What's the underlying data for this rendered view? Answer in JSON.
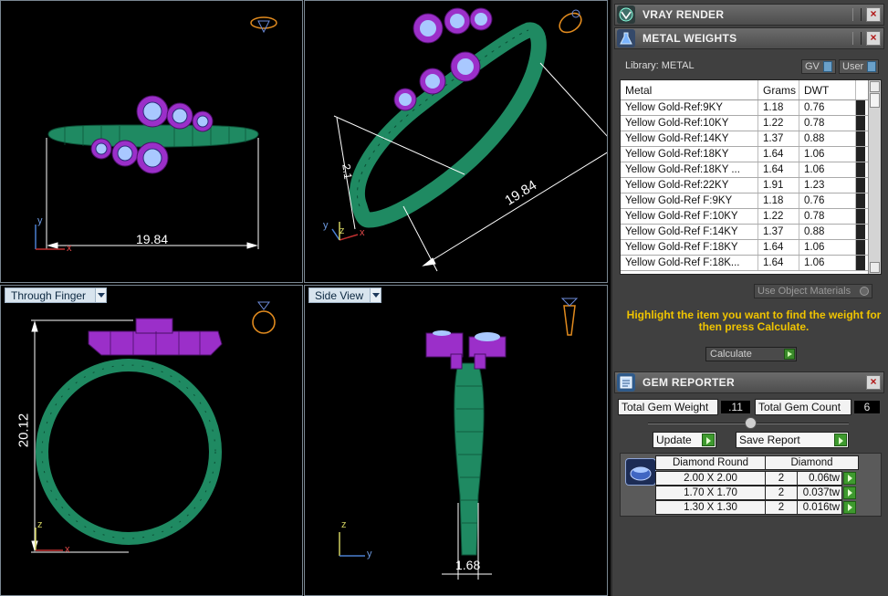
{
  "viewports": {
    "top_left": {
      "dimension": "19.84"
    },
    "top_right": {
      "dimension": "19.84",
      "dimension_small": "2.1"
    },
    "bottom_left": {
      "tab_label": "Through Finger",
      "dimension": "20.12"
    },
    "bottom_right": {
      "tab_label": "Side View",
      "dimension": "1.68"
    },
    "axes": {
      "x": "x",
      "y": "y",
      "z": "z"
    }
  },
  "panel": {
    "vray": {
      "title": "VRAY RENDER",
      "close": "×"
    },
    "metal_weights": {
      "title": "METAL WEIGHTS",
      "close": "×",
      "library_label": "Library: METAL",
      "gv_label": "GV",
      "user_label": "User",
      "columns": [
        "Metal",
        "Grams",
        "DWT"
      ],
      "rows": [
        [
          "Yellow Gold-Ref:9KY",
          "1.18",
          "0.76"
        ],
        [
          "Yellow Gold-Ref:10KY",
          "1.22",
          "0.78"
        ],
        [
          "Yellow Gold-Ref:14KY",
          "1.37",
          "0.88"
        ],
        [
          "Yellow Gold-Ref:18KY",
          "1.64",
          "1.06"
        ],
        [
          "Yellow Gold-Ref:18KY ...",
          "1.64",
          "1.06"
        ],
        [
          "Yellow Gold-Ref:22KY",
          "1.91",
          "1.23"
        ],
        [
          "Yellow Gold-Ref F:9KY",
          "1.18",
          "0.76"
        ],
        [
          "Yellow Gold-Ref F:10KY",
          "1.22",
          "0.78"
        ],
        [
          "Yellow Gold-Ref F:14KY",
          "1.37",
          "0.88"
        ],
        [
          "Yellow Gold-Ref F:18KY",
          "1.64",
          "1.06"
        ],
        [
          "Yellow Gold-Ref F:18K...",
          "1.64",
          "1.06"
        ]
      ],
      "use_object_materials": "Use Object Materials",
      "instructions": "Highlight the item you want to find the weight for then press Calculate.",
      "calculate_label": "Calculate"
    },
    "gem_reporter": {
      "title": "GEM REPORTER",
      "close": "×",
      "total_weight_label": "Total Gem Weight",
      "total_weight_value": ".11",
      "total_count_label": "Total Gem Count",
      "total_count_value": "6",
      "update_label": "Update",
      "save_report_label": "Save Report",
      "gem_type": "Diamond Round",
      "material": "Diamond",
      "rows": [
        {
          "size": "2.00 X 2.00",
          "count": "2",
          "weight": "0.06tw"
        },
        {
          "size": "1.70 X 1.70",
          "count": "2",
          "weight": "0.037tw"
        },
        {
          "size": "1.30 X 1.30",
          "count": "2",
          "weight": "0.016tw"
        }
      ]
    }
  },
  "colors": {
    "metal_green": "#1f8a62",
    "gem_purple": "#9b2fc9",
    "gem_face": "#a9c8ff",
    "dimension_line": "#ffffff",
    "accent_yellow": "#f0c400"
  }
}
